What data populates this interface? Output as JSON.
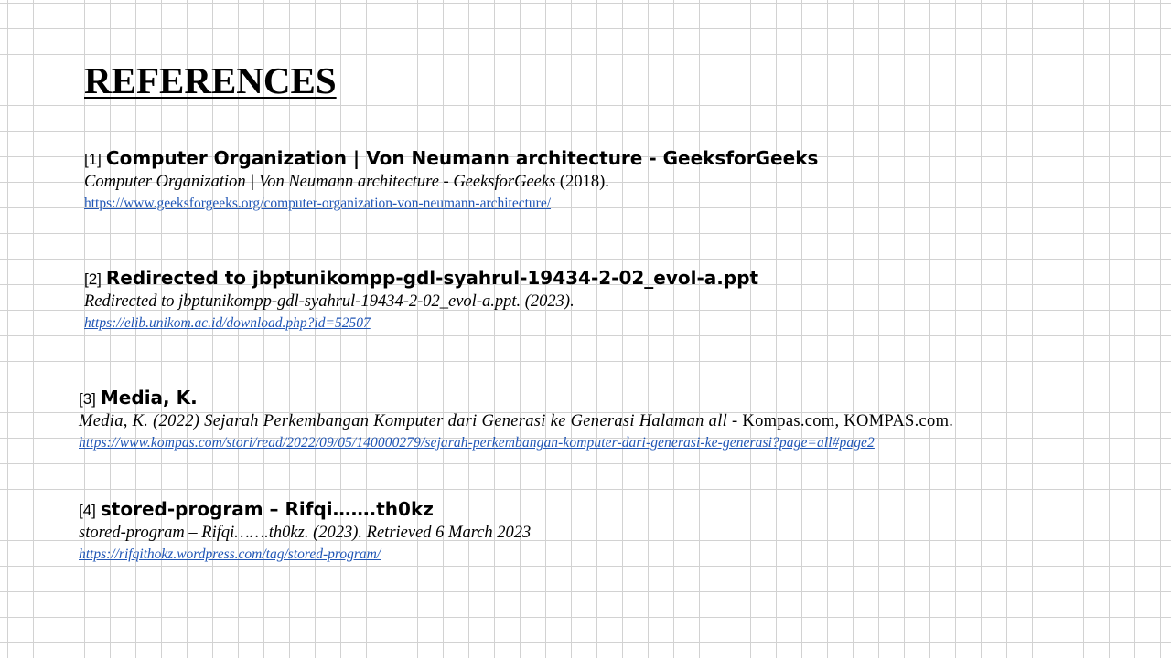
{
  "title": "REFERENCES",
  "references": [
    {
      "number": "[1]",
      "heading": "Computer Organization | Von Neumann architecture - GeeksforGeeks",
      "citation": "Computer Organization | Von Neumann architecture - GeeksforGeeks",
      "citation_suffix": " (2018).",
      "url": "https://www.geeksforgeeks.org/computer-organization-von-neumann-architecture/"
    },
    {
      "number": "[2]",
      "heading": "Redirected to jbptunikompp-gdl-syahrul-19434-2-02_evol-a.ppt",
      "citation": "Redirected to jbptunikompp-gdl-syahrul-19434-2-02_evol-a.ppt. (2023).",
      "url": "https://elib.unikom.ac.id/download.php?id=52507"
    },
    {
      "number": "[3]",
      "heading": "Media, K.",
      "citation": "Media, K. (2022) Sejarah Perkembangan Komputer dari Generasi ke Generasi Halaman all",
      "citation_suffix": " - Kompas.com, KOMPAS.com.",
      "url": "https://www.kompas.com/stori/read/2022/09/05/140000279/sejarah-perkembangan-komputer-dari-generasi-ke-generasi?page=all#page2"
    },
    {
      "number": "[4]",
      "heading": "stored-program – Rifqi…….th0kz",
      "citation": "stored-program – Rifqi…….th0kz. (2023). Retrieved 6 March 2023",
      "url": "https://rifqithokz.wordpress.com/tag/stored-program/"
    }
  ]
}
